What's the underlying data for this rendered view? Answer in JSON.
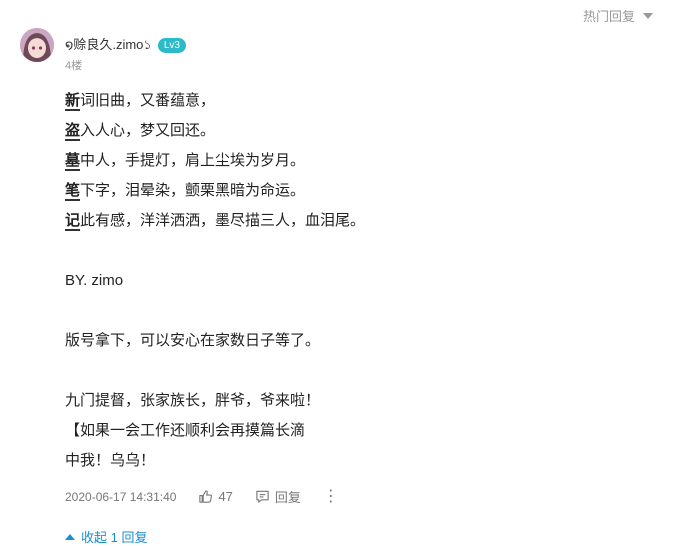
{
  "sort_label": "热门回复",
  "user": {
    "name": "໑赊良久.zimo১",
    "level": "Lv3",
    "floor": "4楼"
  },
  "poem": [
    {
      "first": "新",
      "rest": "词旧曲，又番蕴意，"
    },
    {
      "first": "盗",
      "rest": "入人心，梦又回还。"
    },
    {
      "first": "墓",
      "rest": "中人，手提灯，肩上尘埃为岁月。"
    },
    {
      "first": "笔",
      "rest": "下字，泪晕染，颤栗黑暗为命运。"
    },
    {
      "first": "记",
      "rest": "此有感，洋洋洒洒，墨尽描三人，血泪尾。"
    }
  ],
  "by_line": "BY. zimo",
  "para1": "版号拿下，可以安心在家数日子等了。",
  "para2": [
    "九门提督，张家族长，胖爷，爷来啦！",
    "【如果一会工作还顺利会再摸篇长滴",
    "中我！乌乌！"
  ],
  "meta": {
    "time": "2020-06-17 14:31:40",
    "likes": "47",
    "reply_label": "回复"
  },
  "collapse_label": "收起 1 回复",
  "colors": {
    "level_badge": "#2cb9c8",
    "link": "#1a8ecf"
  }
}
